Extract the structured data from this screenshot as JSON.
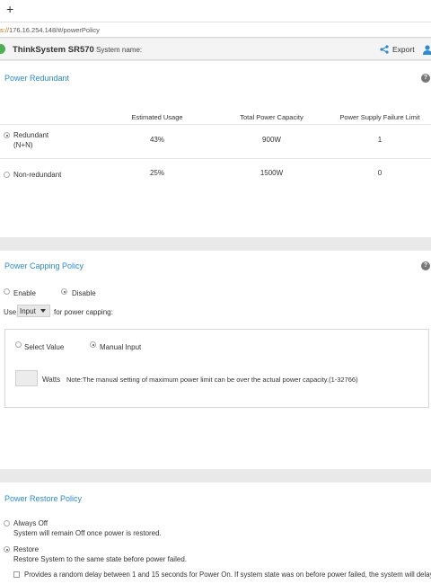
{
  "browser": {
    "new_tab": "+",
    "url_proto": "s://",
    "url_rest": "176.16.254.148/#/powerPolicy"
  },
  "header": {
    "product": "ThinkSystem SR570",
    "system_name_label": "System name:",
    "export_label": "Export"
  },
  "redundant": {
    "title": "Power Redundant",
    "columns": [
      "Estimated Usage",
      "Total Power Capacity",
      "Power Supply Failure Limit"
    ],
    "rows": [
      {
        "label_line1": "Redundant",
        "label_line2": "(N+N)",
        "selected": true,
        "usage": "43%",
        "capacity": "900W",
        "limit": "1"
      },
      {
        "label_line1": "Non-redundant",
        "label_line2": "",
        "selected": false,
        "usage": "25%",
        "capacity": "1500W",
        "limit": "0"
      }
    ]
  },
  "capping": {
    "title": "Power Capping Policy",
    "enable_label": "Enable",
    "disable_label": "Disable",
    "selected": "Disable",
    "use_prefix": "Use",
    "use_value": "Input",
    "use_suffix": "for power capping:",
    "select_value_label": "Select Value",
    "manual_input_label": "Manual Input",
    "manual_selected": true,
    "watts_label": "Watts",
    "note": "Note:The manual setting of maximum power limit can be over the actual power capacity.(1-32766)"
  },
  "restore": {
    "title": "Power Restore Policy",
    "options": [
      {
        "label": "Always Off",
        "desc": "System will remain Off once power is restored.",
        "selected": false
      },
      {
        "label": "Restore",
        "desc": "Restore System to the same state before power failed.",
        "selected": true
      }
    ],
    "delay_text": "Provides a random delay between 1 and 15 seconds for Power On. If system state was on before power failed, the system will delay"
  },
  "colors": {
    "accent": "#2a8ad4",
    "logo": "#4caf50"
  }
}
